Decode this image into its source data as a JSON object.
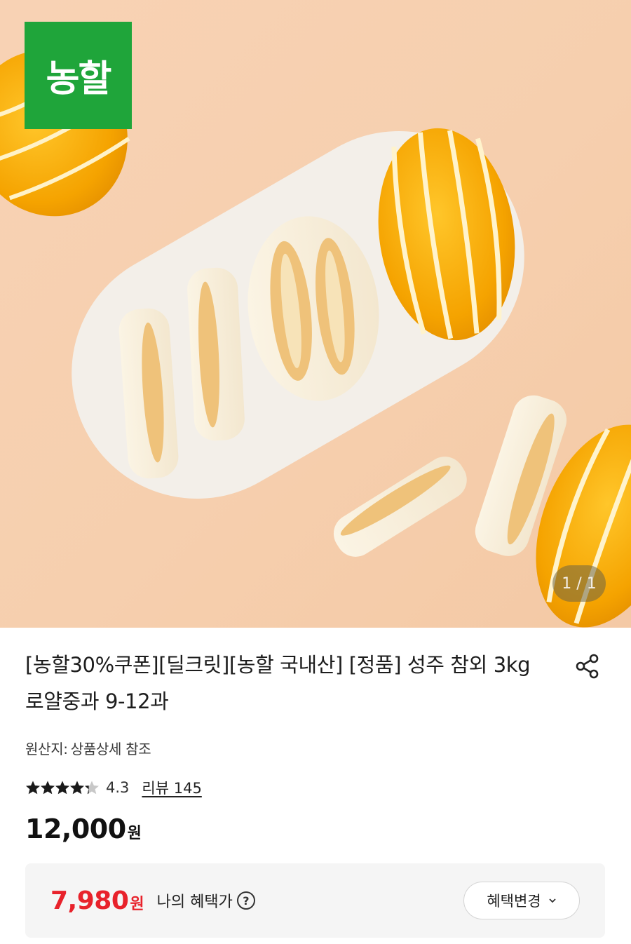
{
  "hero": {
    "brand_badge": "농할",
    "image_counter": "1 / 1"
  },
  "product": {
    "title": "[농할30%쿠폰][딜크릿][농할 국내산] [정품] 성주 참외 3kg 로얄중과 9-12과",
    "origin_label": "원산지:",
    "origin_value": "상품상세 참조",
    "rating": 4.3,
    "rating_text": "4.3",
    "review_link": "리뷰 145",
    "price": "12,000",
    "price_unit": "원"
  },
  "benefit": {
    "price": "7,980",
    "price_unit": "원",
    "label": "나의 혜택가",
    "help_icon": "?",
    "change_button": "혜택변경"
  },
  "colors": {
    "brand_green": "#1fa53a",
    "benefit_red": "#e8222b",
    "star": "#1a1a1a",
    "star_empty": "#c8c8c8"
  },
  "icons": [
    "share-icon",
    "star-icon",
    "question-circle-icon",
    "chevron-down-icon"
  ]
}
